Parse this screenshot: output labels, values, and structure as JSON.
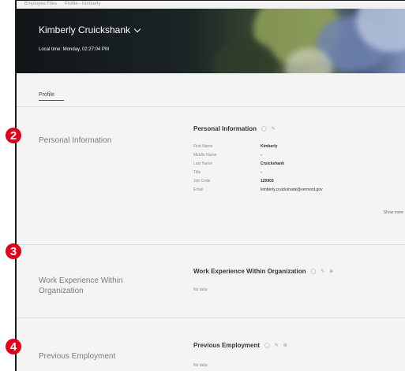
{
  "topbar": {
    "crumb1": "Employee Files",
    "crumb2": "Profile - Kimberly"
  },
  "header": {
    "employee_name": "Kimberly Cruickshank",
    "local_time": "Local time: Monday, 02:27:04 PM"
  },
  "tabs": [
    {
      "label": "Profile"
    }
  ],
  "sections": {
    "personal": {
      "badge": "2",
      "title": "Personal Information",
      "card_title": "Personal Information",
      "icons": [
        "history-icon",
        "edit-icon"
      ],
      "fields": [
        {
          "label": "First Name",
          "value": "Kimberly"
        },
        {
          "label": "Middle Name",
          "value": "-"
        },
        {
          "label": "Last Name",
          "value": "Cruickshank"
        },
        {
          "label": "Title",
          "value": "-"
        },
        {
          "label": "Job Code",
          "value": "125903"
        },
        {
          "label": "Email",
          "value": "kimberly.cruickshank@vermont.gov"
        }
      ],
      "show_more": "Show more"
    },
    "work_experience": {
      "badge": "3",
      "title_line1": "Work Experience Within",
      "title_line2": "Organization",
      "card_title": "Work Experience Within Organization",
      "no_data": "No data"
    },
    "previous_employment": {
      "badge": "4",
      "title": "Previous Employment",
      "card_title": "Previous Employment",
      "no_data": "No data"
    }
  },
  "colors": {
    "badge": "#e3001b",
    "header_dark": "#111517",
    "page_bg": "#f4f4f4"
  }
}
